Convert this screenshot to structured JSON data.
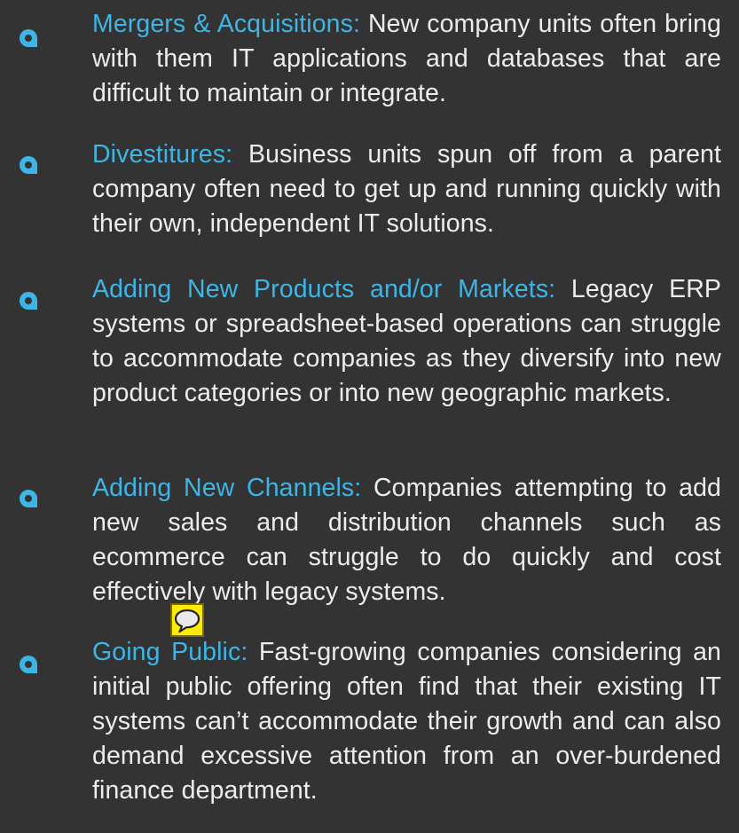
{
  "items": [
    {
      "lead": "Mergers & Acquisitions:",
      "body": " New company units often bring with them IT applications and databases that are difficult to maintain or integrate."
    },
    {
      "lead": "Divestitures:",
      "body": " Business units spun off from a parent company often need to get up and running quickly with their own, independent IT solutions."
    },
    {
      "lead": "Adding New Products and/or Markets:",
      "body": " Legacy ERP systems or spreadsheet-based operations can struggle to accommodate companies as they diversify into new product categories or into new geographic markets."
    },
    {
      "lead": "Adding New Channels:",
      "body": " Companies attempting to add new sales and distribution channels such as ecommerce can struggle to do quickly and cost effectively with legacy systems."
    },
    {
      "lead": "Going Public:",
      "body": " Fast-growing companies considering an initial public offering often find that their existing IT systems can’t accommodate their growth and can also demand excessive attention from an over-burdened finance department."
    }
  ],
  "colors": {
    "background": "#333333",
    "accent": "#3db5e6",
    "text": "#ececec",
    "comment_icon": "#ffeb00"
  },
  "icons": {
    "bullet": "map-pin-bullet-icon",
    "comment": "comment-note-icon"
  }
}
